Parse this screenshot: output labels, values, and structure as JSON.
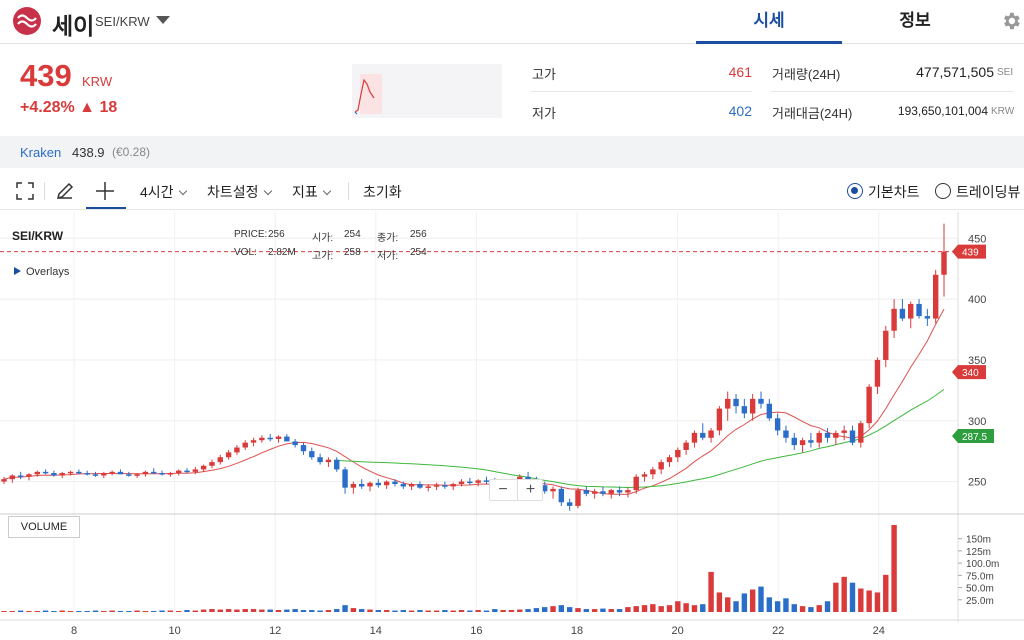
{
  "header": {
    "coin_name": "세이",
    "pair": "SEI/KRW",
    "tabs": [
      {
        "label": "시세",
        "active": true
      },
      {
        "label": "정보",
        "active": false
      }
    ]
  },
  "summary": {
    "price": "439",
    "unit": "KRW",
    "change": "+4.28% ▲ 18",
    "high_label": "고가",
    "high_value": "461",
    "low_label": "저가",
    "low_value": "402",
    "volume_label": "거래량(24H)",
    "volume_value": "477,571,505",
    "volume_unit": "SEI",
    "amount_label": "거래대금(24H)",
    "amount_value": "193,650,101,004",
    "amount_unit": "KRW"
  },
  "exchange": {
    "name": "Kraken",
    "price": "438.9",
    "sub": "(€0.28)"
  },
  "toolbar": {
    "interval": "4시간",
    "chart_settings": "차트설정",
    "indicators": "지표",
    "reset": "초기화",
    "view_basic": "기본차트",
    "view_trading": "트레이딩뷰"
  },
  "chart": {
    "symbol": "SEI/KRW",
    "ohlc": {
      "price_label": "PRICE:",
      "price": "256",
      "open_label": "시가:",
      "open": "254",
      "close_label": "종가:",
      "close": "256",
      "vol_label": "VOL:",
      "vol": "2.82M",
      "high_label": "고가:",
      "high": "258",
      "low_label": "저가:",
      "low": "254"
    },
    "overlays_label": "Overlays",
    "volume_label": "VOLUME",
    "zoom_minus": "−",
    "zoom_plus": "+",
    "price_axis": [
      "450",
      "400",
      "350",
      "300",
      "250"
    ],
    "volume_axis": [
      "150m",
      "125m",
      "100.0m",
      "75.0m",
      "50.0m",
      "25.0m"
    ],
    "x_axis": [
      "8",
      "10",
      "12",
      "14",
      "16",
      "18",
      "20",
      "22",
      "24"
    ],
    "badges": [
      {
        "value": "439",
        "color": "#d93a3a"
      },
      {
        "value": "340",
        "color": "#d93a3a"
      },
      {
        "value": "287.5",
        "color": "#2e9e3e"
      }
    ],
    "colors": {
      "up": "#d93a3a",
      "down": "#2a6ec9",
      "ma_short": "#e05050",
      "ma_long": "#3cb83c"
    }
  },
  "chart_data": {
    "type": "candlestick",
    "y_range": [
      225,
      465
    ],
    "candles": [
      [
        250,
        254,
        248,
        252
      ],
      [
        252,
        256,
        249,
        255
      ],
      [
        255,
        258,
        252,
        254
      ],
      [
        254,
        257,
        251,
        256
      ],
      [
        256,
        259,
        254,
        258
      ],
      [
        258,
        260,
        256,
        257
      ],
      [
        257,
        259,
        254,
        255
      ],
      [
        255,
        258,
        253,
        257
      ],
      [
        257,
        259,
        255,
        258
      ],
      [
        258,
        260,
        256,
        257
      ],
      [
        257,
        259,
        255,
        256
      ],
      [
        256,
        258,
        254,
        255
      ],
      [
        255,
        258,
        253,
        257
      ],
      [
        257,
        259,
        255,
        258
      ],
      [
        258,
        260,
        256,
        256
      ],
      [
        256,
        258,
        254,
        255
      ],
      [
        255,
        257,
        253,
        256
      ],
      [
        256,
        259,
        254,
        258
      ],
      [
        258,
        261,
        256,
        257
      ],
      [
        257,
        259,
        255,
        256
      ],
      [
        256,
        258,
        254,
        257
      ],
      [
        257,
        260,
        255,
        259
      ],
      [
        259,
        261,
        257,
        258
      ],
      [
        258,
        262,
        256,
        260
      ],
      [
        260,
        264,
        258,
        263
      ],
      [
        263,
        268,
        261,
        266
      ],
      [
        266,
        272,
        264,
        270
      ],
      [
        270,
        276,
        268,
        274
      ],
      [
        274,
        280,
        272,
        278
      ],
      [
        278,
        284,
        276,
        282
      ],
      [
        282,
        286,
        279,
        284
      ],
      [
        284,
        288,
        282,
        286
      ],
      [
        286,
        289,
        283,
        285
      ],
      [
        285,
        288,
        282,
        287
      ],
      [
        287,
        289,
        284,
        283
      ],
      [
        283,
        285,
        278,
        280
      ],
      [
        280,
        282,
        272,
        275
      ],
      [
        275,
        278,
        268,
        270
      ],
      [
        270,
        273,
        264,
        266
      ],
      [
        266,
        270,
        262,
        268
      ],
      [
        268,
        270,
        258,
        260
      ],
      [
        260,
        262,
        240,
        245
      ],
      [
        245,
        250,
        240,
        248
      ],
      [
        248,
        252,
        244,
        246
      ],
      [
        246,
        250,
        242,
        249
      ],
      [
        249,
        252,
        245,
        247
      ],
      [
        247,
        251,
        244,
        250
      ],
      [
        250,
        252,
        246,
        248
      ],
      [
        248,
        250,
        244,
        246
      ],
      [
        246,
        249,
        243,
        248
      ],
      [
        248,
        250,
        244,
        245
      ],
      [
        245,
        248,
        242,
        246
      ],
      [
        246,
        249,
        243,
        247
      ],
      [
        247,
        250,
        244,
        246
      ],
      [
        246,
        249,
        243,
        248
      ],
      [
        248,
        252,
        246,
        250
      ],
      [
        250,
        253,
        247,
        249
      ],
      [
        249,
        252,
        246,
        251
      ],
      [
        251,
        254,
        248,
        250
      ],
      [
        250,
        253,
        240,
        243
      ],
      [
        243,
        248,
        240,
        246
      ],
      [
        246,
        250,
        243,
        248
      ],
      [
        248,
        256,
        246,
        254
      ],
      [
        254,
        258,
        250,
        252
      ],
      [
        252,
        254,
        246,
        247
      ],
      [
        247,
        250,
        240,
        242
      ],
      [
        242,
        246,
        236,
        244
      ],
      [
        244,
        246,
        230,
        233
      ],
      [
        233,
        236,
        226,
        230
      ],
      [
        230,
        245,
        228,
        243
      ],
      [
        243,
        246,
        238,
        240
      ],
      [
        240,
        244,
        236,
        242
      ],
      [
        242,
        246,
        238,
        240
      ],
      [
        240,
        244,
        236,
        243
      ],
      [
        243,
        246,
        238,
        241
      ],
      [
        241,
        245,
        237,
        243
      ],
      [
        243,
        256,
        240,
        254
      ],
      [
        254,
        258,
        250,
        256
      ],
      [
        256,
        262,
        252,
        260
      ],
      [
        260,
        268,
        256,
        266
      ],
      [
        266,
        272,
        262,
        270
      ],
      [
        270,
        278,
        266,
        276
      ],
      [
        276,
        284,
        272,
        282
      ],
      [
        282,
        292,
        278,
        290
      ],
      [
        290,
        298,
        284,
        286
      ],
      [
        286,
        294,
        282,
        292
      ],
      [
        292,
        312,
        288,
        310
      ],
      [
        310,
        324,
        300,
        318
      ],
      [
        318,
        322,
        306,
        312
      ],
      [
        312,
        318,
        302,
        306
      ],
      [
        306,
        322,
        300,
        318
      ],
      [
        318,
        324,
        310,
        314
      ],
      [
        314,
        318,
        300,
        302
      ],
      [
        302,
        306,
        288,
        292
      ],
      [
        292,
        296,
        282,
        286
      ],
      [
        286,
        290,
        276,
        280
      ],
      [
        280,
        286,
        274,
        284
      ],
      [
        284,
        290,
        278,
        282
      ],
      [
        282,
        292,
        278,
        290
      ],
      [
        290,
        294,
        282,
        286
      ],
      [
        286,
        292,
        280,
        290
      ],
      [
        290,
        296,
        284,
        292
      ],
      [
        292,
        296,
        280,
        282
      ],
      [
        282,
        300,
        278,
        298
      ],
      [
        298,
        330,
        294,
        328
      ],
      [
        328,
        352,
        322,
        350
      ],
      [
        350,
        378,
        344,
        374
      ],
      [
        374,
        400,
        368,
        392
      ],
      [
        392,
        400,
        382,
        384
      ],
      [
        384,
        398,
        376,
        396
      ],
      [
        396,
        400,
        384,
        386
      ],
      [
        386,
        392,
        378,
        384
      ],
      [
        384,
        424,
        380,
        420
      ],
      [
        420,
        462,
        402,
        439
      ]
    ],
    "volume_m": [
      2,
      2,
      3,
      2,
      2,
      3,
      2,
      3,
      2,
      2,
      2,
      3,
      2,
      3,
      2,
      2,
      3,
      2,
      2,
      3,
      3,
      2,
      4,
      3,
      5,
      6,
      5,
      6,
      5,
      6,
      6,
      5,
      5,
      4,
      5,
      6,
      4,
      4,
      3,
      4,
      6,
      14,
      8,
      6,
      5,
      4,
      4,
      3,
      4,
      3,
      4,
      3,
      3,
      4,
      3,
      4,
      3,
      4,
      3,
      6,
      4,
      4,
      5,
      6,
      8,
      10,
      12,
      14,
      10,
      8,
      6,
      6,
      7,
      6,
      6,
      10,
      12,
      14,
      16,
      12,
      14,
      22,
      18,
      14,
      16,
      82,
      40,
      30,
      22,
      38,
      46,
      52,
      30,
      22,
      28,
      16,
      12,
      10,
      14,
      22,
      60,
      72,
      60,
      48,
      44,
      40,
      76,
      178
    ]
  }
}
